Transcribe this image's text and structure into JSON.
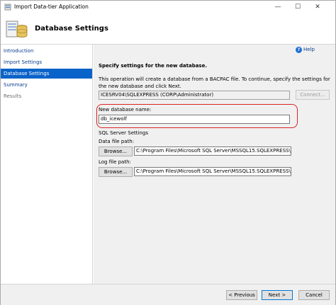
{
  "window": {
    "title": "Import Data-tier Application",
    "minimize_glyph": "—",
    "maximize_glyph": "☐",
    "close_glyph": "✕"
  },
  "header": {
    "title": "Database Settings"
  },
  "sidebar": {
    "items": [
      {
        "label": "Introduction",
        "state": "normal"
      },
      {
        "label": "Import Settings",
        "state": "normal"
      },
      {
        "label": "Database Settings",
        "state": "active"
      },
      {
        "label": "Summary",
        "state": "normal"
      },
      {
        "label": "Results",
        "state": "disabled"
      }
    ]
  },
  "main": {
    "help_label": "Help",
    "help_glyph": "?",
    "section_title": "Specify settings for the new database.",
    "description": "This operation will create a database from a BACPAC file. To continue, specify the settings for the new database and click Next.",
    "server_connection": "ICESRV04\\SQLEXPRESS (CORP\\Administrator)",
    "connect_label": "Connect...",
    "new_db_label": "New database name:",
    "new_db_value": "db_icewolf",
    "sql_settings_label": "SQL Server Settings",
    "data_file_label": "Data file path:",
    "data_file_value": "C:\\Program Files\\Microsoft SQL Server\\MSSQL15.SQLEXPRESS\\MSSQL\\D",
    "log_file_label": "Log file path:",
    "log_file_value": "C:\\Program Files\\Microsoft SQL Server\\MSSQL15.SQLEXPRESS\\MSSQL\\D",
    "browse_label": "Browse..."
  },
  "footer": {
    "previous_label": "< Previous",
    "next_label": "Next >",
    "cancel_label": "Cancel"
  },
  "colors": {
    "accent": "#0a63c9",
    "highlight_box": "#dd2222"
  }
}
